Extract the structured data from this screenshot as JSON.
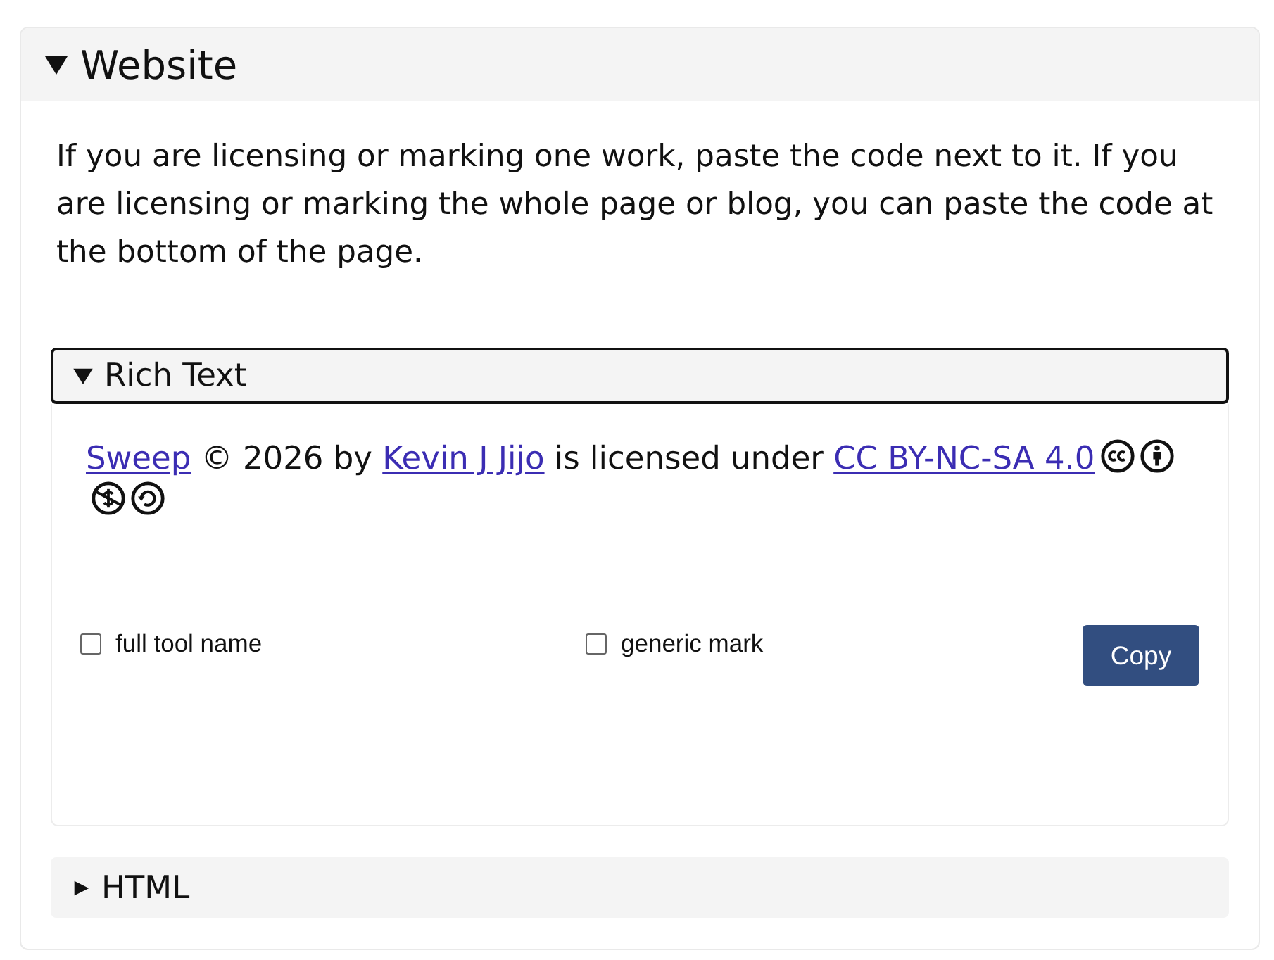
{
  "section": {
    "title": "Website",
    "expanded": true,
    "description": "If you are licensing or marking one work, paste the code next to it. If you are licensing or marking the whole page or blog, you can paste the code at the bottom of the page.",
    "subsections": [
      {
        "title": "Rich Text",
        "expanded": true,
        "focused": true,
        "attribution": [
          {
            "kind": "link",
            "text": "Sweep"
          },
          {
            "kind": "text",
            "text": " © 2026 by "
          },
          {
            "kind": "link",
            "text": "Kevin J Jijo"
          },
          {
            "kind": "text",
            "text": " is licensed under "
          },
          {
            "kind": "link",
            "text": "CC BY-NC-SA 4.0"
          }
        ],
        "options": [
          {
            "label": "full tool name",
            "checked": false
          },
          {
            "label": "generic mark",
            "checked": false
          }
        ],
        "copy_button": "Copy"
      },
      {
        "title": "HTML",
        "expanded": false,
        "focused": false
      }
    ]
  }
}
